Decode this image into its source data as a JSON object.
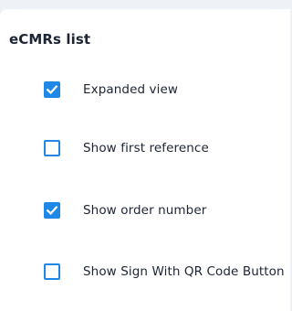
{
  "panel": {
    "title": "eCMRs list"
  },
  "options": [
    {
      "label": "Expanded view",
      "checked": true,
      "icon": "checkmark-icon"
    },
    {
      "label": "Show first reference",
      "checked": false,
      "icon": ""
    },
    {
      "label": "Show order number",
      "checked": true,
      "icon": "checkmark-icon"
    },
    {
      "label": "Show Sign With QR Code Button",
      "checked": false,
      "icon": ""
    }
  ],
  "colors": {
    "accent": "#1f87e5",
    "background": "#eef1f5",
    "panel": "#ffffff",
    "text": "#1d2433"
  }
}
